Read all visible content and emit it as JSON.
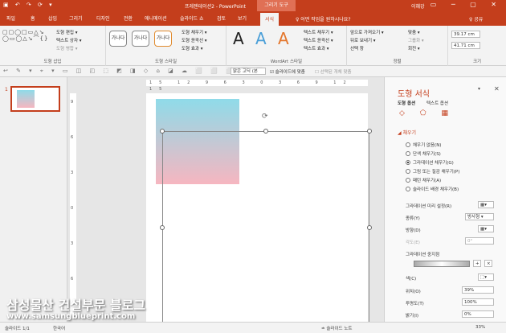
{
  "app": {
    "quick_access": "▣ ↶ ↷ ⟳ ▾",
    "doc_title": "프레젠테이션2 - PowerPoint",
    "context_tool": "그리기 도구",
    "user": "이혜강",
    "window_controls": "▭ ─ ▢ ✕"
  },
  "tabs": [
    "파일",
    "홈",
    "삽입",
    "그리기",
    "디자인",
    "전환",
    "애니메이션",
    "슬라이드 쇼",
    "검토",
    "보기",
    "서식"
  ],
  "tell_me": "♀ 어떤 작업을 원하시나요?",
  "share": "♀ 공유",
  "ribbon": {
    "insert_shapes": {
      "label": "도형 삽입",
      "shapes_glyphs": "▢▢◯□▭△↘\n◯▭◯△↘⌒{}",
      "edit_shape": "도형 편집 ▾",
      "text_box": "텍스트 상자 ▾",
      "merge_shapes": "도형 병합 ▾"
    },
    "shape_styles": {
      "label": "도형 스타일",
      "style_samples": [
        "가나다",
        "가나다",
        "가나다"
      ],
      "fill": "도형 채우기 ▾",
      "outline": "도형 윤곽선 ▾",
      "effects": "도형 효과 ▾"
    },
    "wordart": {
      "label": "WordArt 스타일",
      "samples": [
        "A",
        "A",
        "A"
      ],
      "sample_colors": [
        "#222222",
        "#4a9fd8",
        "#e4772d"
      ],
      "text_fill": "텍스트 채우기 ▾",
      "text_outline": "텍스트 윤곽선 ▾",
      "text_effects": "텍스트 효과 ▾"
    },
    "arrange": {
      "label": "정렬",
      "bring_forward": "앞으로 가져오기 ▾",
      "send_backward": "뒤로 보내기 ▾",
      "selection_pane": "선택 창",
      "align": "맞춤 ▾",
      "group": "그룹화 ▾",
      "rotate": "회전 ▾"
    },
    "size": {
      "label": "크기",
      "height": "39.17 cm",
      "width": "41.71 cm"
    }
  },
  "toolbar2": {
    "icons": "↩ ✎ ▾ ⌖ ▾ ▭ ◫ ◰ ⬚ ◩ ◨ ◇ ⌂ ◪ ☁ ⬜ ⬜ ⬜ ⬜ ⬜",
    "font": "맑은 고딕 (본",
    "fit_slide": "☑ 슬라이드에 맞춤",
    "selected_object": "☐ 선택된 개체 맞춤"
  },
  "thumbs": {
    "slide_number": "1"
  },
  "canvas": {
    "hruler_ticks": "15 12 9 6 3 0 3 6 9 12 15",
    "vruler_ticks": [
      "9",
      "6",
      "3",
      "0",
      "3",
      "6"
    ]
  },
  "format_pane": {
    "title": "도형 서식",
    "dropdown": "▾",
    "close": "✕",
    "subtab_shape": "도형 옵션",
    "subtab_text": "텍스트 옵션",
    "icons": "◇ ⬠ ▦",
    "section": "◢ 채우기",
    "fill_options": [
      {
        "label": "채우기 없음(N)",
        "selected": false
      },
      {
        "label": "단색 채우기(S)",
        "selected": false
      },
      {
        "label": "그라데이션 채우기(G)",
        "selected": true
      },
      {
        "label": "그림 또는 질감 채우기(P)",
        "selected": false
      },
      {
        "label": "패턴 채우기(A)",
        "selected": false
      },
      {
        "label": "슬라이드 배경 채우기(B)",
        "selected": false
      }
    ],
    "preset_label": "그라데이션 미리 설정(R)",
    "type_label": "종류(Y)",
    "type_value": "방사형 ▾",
    "direction_label": "방향(D)",
    "angle_label": "각도(E)",
    "angle_value": "0°",
    "stops_label": "그라데이션 중지점",
    "color_label": "색(C)",
    "position_label": "위치(O)",
    "position_value": "39%",
    "transparency_label": "투명도(T)",
    "transparency_value": "100%",
    "brightness_label": "밝기(I)",
    "brightness_value": "0%"
  },
  "status": {
    "slide": "슬라이드 1/1",
    "language": "한국어",
    "notes": "≐ 슬라이드 노트",
    "zoom": "33%"
  },
  "watermark": {
    "line1": "삼성물산 건설부문 블로그",
    "line2": "www.samsungblueprint.com"
  }
}
